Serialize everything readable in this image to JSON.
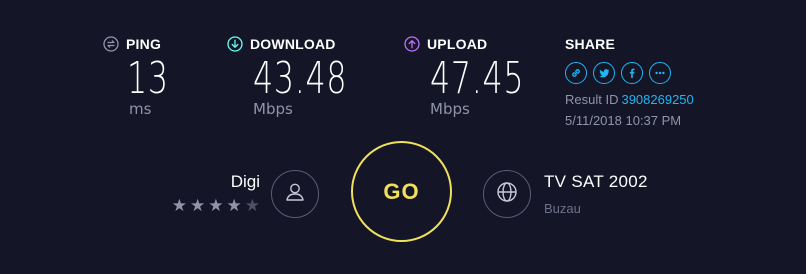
{
  "results": {
    "ping": {
      "label": "PING",
      "value": "13",
      "unit": "ms",
      "icon": "ping-icon",
      "color": "#9193a8"
    },
    "download": {
      "label": "DOWNLOAD",
      "value": "43.48",
      "unit": "Mbps",
      "icon": "download-arrow-icon",
      "color": "#6afff3"
    },
    "upload": {
      "label": "UPLOAD",
      "value": "47.45",
      "unit": "Mbps",
      "icon": "upload-arrow-icon",
      "color": "#bf71ff"
    }
  },
  "share": {
    "label": "SHARE",
    "icons": [
      "link-icon",
      "twitter-icon",
      "facebook-icon",
      "more-icon"
    ],
    "result_id_label": "Result ID",
    "result_id": "3908269250",
    "date": "5/11/2018 10:37 PM",
    "accent_color": "#1fb6f2"
  },
  "isp": {
    "name": "Digi",
    "rating": 4,
    "rating_max": 5
  },
  "go": {
    "label": "GO",
    "color": "#f0e05a"
  },
  "server": {
    "name": "TV SAT 2002",
    "location": "Buzau"
  }
}
